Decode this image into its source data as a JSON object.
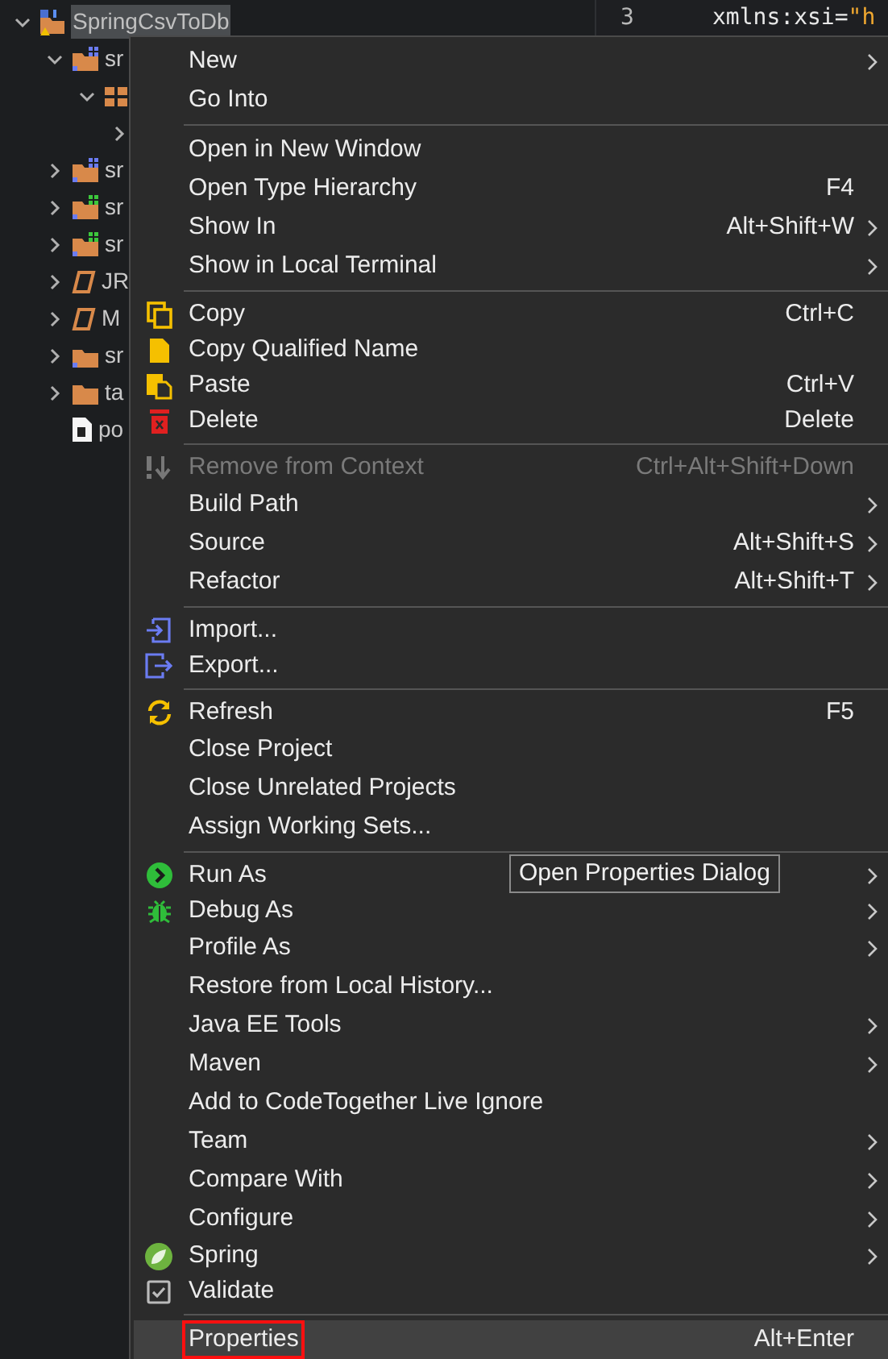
{
  "tree": [
    {
      "label": "SpringCsvToDb",
      "kind": "project",
      "expanded": true,
      "selected": true,
      "children": [
        {
          "label": "sr",
          "kind": "source_blue",
          "expanded": true,
          "selected": false,
          "children": [
            {
              "kind": "package",
              "expanded": true,
              "children": [
                {
                  "expanded": false
                }
              ]
            }
          ]
        },
        {
          "label": "sr",
          "kind": "source_blue",
          "expanded": false,
          "selected": false
        },
        {
          "label": "sr",
          "kind": "source_green",
          "expanded": false,
          "selected": false
        },
        {
          "label": "sr",
          "kind": "source_green",
          "expanded": false,
          "selected": false
        },
        {
          "label": "JR",
          "kind": "library",
          "expanded": false,
          "selected": false
        },
        {
          "label": "M",
          "kind": "library",
          "expanded": false,
          "selected": false
        },
        {
          "label": "sr",
          "kind": "folder_badge",
          "expanded": false,
          "selected": false
        },
        {
          "label": "ta",
          "kind": "folder",
          "expanded": false,
          "selected": false
        },
        {
          "label": "po",
          "kind": "file",
          "selected": false
        }
      ]
    }
  ],
  "editor": {
    "lines": [
      {
        "number": "3",
        "attribute": "xmlns:xsi=",
        "value": "\"h"
      }
    ]
  },
  "context_menu": {
    "groups": [
      [
        {
          "label": "New",
          "submenu": true,
          "disabled": false,
          "selected": false
        },
        {
          "label": "Go Into",
          "submenu": false,
          "disabled": false,
          "selected": false
        }
      ],
      [
        {
          "label": "Open in New Window",
          "submenu": false,
          "disabled": false,
          "selected": false
        },
        {
          "label": "Open Type Hierarchy",
          "shortcut": "F4",
          "submenu": false,
          "disabled": false,
          "selected": false
        },
        {
          "label": "Show In",
          "shortcut": "Alt+Shift+W",
          "submenu": true,
          "disabled": false,
          "selected": false
        },
        {
          "label": "Show in Local Terminal",
          "submenu": true,
          "disabled": false,
          "selected": false
        }
      ],
      [
        {
          "label": "Copy",
          "shortcut": "Ctrl+C",
          "kind": "copy",
          "submenu": false,
          "disabled": false,
          "selected": false
        },
        {
          "label": "Copy Qualified Name",
          "kind": "document",
          "submenu": false,
          "disabled": false,
          "selected": false
        },
        {
          "label": "Paste",
          "shortcut": "Ctrl+V",
          "kind": "paste",
          "submenu": false,
          "disabled": false,
          "selected": false
        },
        {
          "label": "Delete",
          "shortcut": "Delete",
          "kind": "delete",
          "submenu": false,
          "disabled": false,
          "selected": false
        }
      ],
      [
        {
          "label": "Remove from Context",
          "shortcut": "Ctrl+Alt+Shift+Down",
          "kind": "remove",
          "submenu": false,
          "disabled": true,
          "selected": false
        },
        {
          "label": "Build Path",
          "submenu": true,
          "disabled": false,
          "selected": false
        },
        {
          "label": "Source",
          "shortcut": "Alt+Shift+S",
          "submenu": true,
          "disabled": false,
          "selected": false
        },
        {
          "label": "Refactor",
          "shortcut": "Alt+Shift+T",
          "submenu": true,
          "disabled": false,
          "selected": false
        }
      ],
      [
        {
          "label": "Import...",
          "kind": "import",
          "submenu": false,
          "disabled": false,
          "selected": false
        },
        {
          "label": "Export...",
          "kind": "export",
          "submenu": false,
          "disabled": false,
          "selected": false
        }
      ],
      [
        {
          "label": "Refresh",
          "shortcut": "F5",
          "kind": "refresh",
          "submenu": false,
          "disabled": false,
          "selected": false
        },
        {
          "label": "Close Project",
          "submenu": false,
          "disabled": false,
          "selected": false
        },
        {
          "label": "Close Unrelated Projects",
          "submenu": false,
          "disabled": false,
          "selected": false
        },
        {
          "label": "Assign Working Sets...",
          "submenu": false,
          "disabled": false,
          "selected": false
        }
      ],
      [
        {
          "label": "Run As",
          "kind": "run",
          "submenu": true,
          "disabled": false,
          "selected": false
        },
        {
          "label": "Debug As",
          "kind": "debug",
          "submenu": true,
          "disabled": false,
          "selected": false
        },
        {
          "label": "Profile As",
          "submenu": true,
          "disabled": false,
          "selected": false
        },
        {
          "label": "Restore from Local History...",
          "submenu": false,
          "disabled": false,
          "selected": false
        },
        {
          "label": "Java EE Tools",
          "submenu": true,
          "disabled": false,
          "selected": false
        },
        {
          "label": "Maven",
          "submenu": true,
          "disabled": false,
          "selected": false
        },
        {
          "label": "Add to CodeTogether Live Ignore",
          "submenu": false,
          "disabled": false,
          "selected": false
        },
        {
          "label": "Team",
          "submenu": true,
          "disabled": false,
          "selected": false
        },
        {
          "label": "Compare With",
          "submenu": true,
          "disabled": false,
          "selected": false
        },
        {
          "label": "Configure",
          "submenu": true,
          "disabled": false,
          "selected": false
        },
        {
          "label": "Spring",
          "kind": "spring",
          "submenu": true,
          "disabled": false,
          "selected": false
        },
        {
          "label": "Validate",
          "kind": "validate",
          "submenu": false,
          "disabled": false,
          "selected": false
        }
      ],
      [
        {
          "label": "Properties",
          "shortcut": "Alt+Enter",
          "submenu": false,
          "disabled": false,
          "selected": true,
          "outlined": true
        }
      ]
    ]
  },
  "tooltip": {
    "text": "Open Properties Dialog"
  }
}
